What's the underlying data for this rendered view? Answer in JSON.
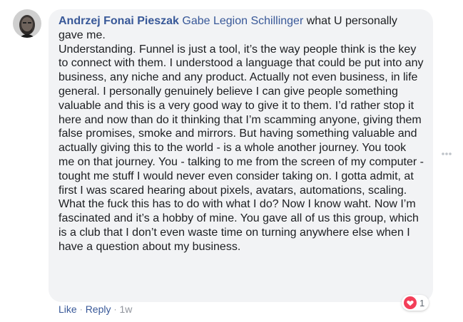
{
  "comment": {
    "author": "Andrzej Fonai Pieszak",
    "mention": "Gabe Legion Schillinger",
    "text": " what U personally gave me.\nUnderstanding. Funnel is just a tool, it’s the way people think is the key to connect with them. I understood a language that could be put into any business, any niche and any product. Actually not even business, in life general. I personally genuinely believe I can give people something valuable and this is a very good way to give it to them. I’d rather stop it here and now than do it thinking that I’m scamming anyone, giving them false promises, smoke and mirrors. But having something valuable and actually giving this to the world - is a whole another journey. You took me on that journey. You - talking to me from the screen of my computer - tought me stuff I would never even consider taking on. I gotta admit, at first I was scared hearing about pixels, avatars, automations, scaling. What the fuck this has to do with what I do? Now I know waht. Now I’m fascinated and it’s a hobby of mine. You gave all of us this group, which is a club that I don’t even waste time on turning anywhere else when I have a question about my business."
  },
  "actions": {
    "like": "Like",
    "reply": "Reply",
    "separator": "·",
    "time": "1w"
  },
  "reactions": {
    "icon": "heart-reaction-icon",
    "count": "1",
    "color": "#f33e58"
  },
  "colors": {
    "link": "#385898",
    "bubble": "#f2f3f5",
    "text": "#1c1e21",
    "meta": "#90949c"
  }
}
